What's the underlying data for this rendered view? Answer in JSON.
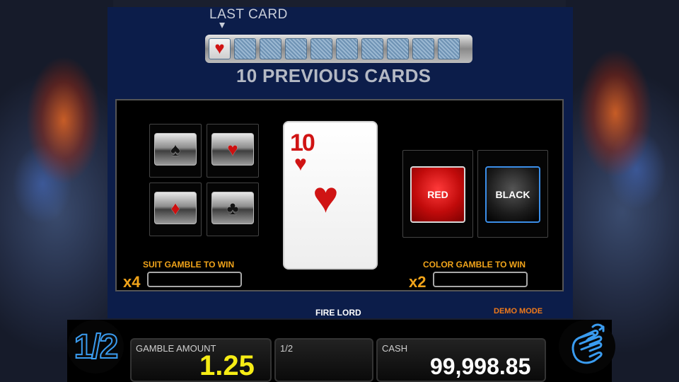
{
  "header": {
    "last_card_label": "LAST CARD",
    "previous_cards_label": "10 PREVIOUS CARDS",
    "history": [
      "♥",
      "",
      "",
      "",
      "",
      "",
      "",
      "",
      "",
      ""
    ]
  },
  "suits": {
    "spade": "♠",
    "heart": "♥",
    "diamond": "♦",
    "club": "♣"
  },
  "current_card": {
    "rank": "10",
    "suit": "♥"
  },
  "color_buttons": {
    "red_label": "RED",
    "black_label": "BLACK"
  },
  "suit_gamble": {
    "label": "SUIT GAMBLE TO WIN",
    "multiplier": "x4",
    "win_value": ""
  },
  "color_gamble": {
    "label": "COLOR GAMBLE TO WIN",
    "multiplier": "x2",
    "win_value": ""
  },
  "footer": {
    "game_name": "FIRE LORD",
    "mode": "DEMO MODE",
    "half_button": "1/2",
    "gamble_amount_label": "GAMBLE AMOUNT",
    "gamble_amount_value": "1.25",
    "half_label": "1/2",
    "cash_label": "CASH",
    "cash_value": "99,998.85"
  },
  "colors": {
    "accent_orange": "#f1a41a",
    "value_yellow": "#f6ec15",
    "panel_blue": "#0c1d4a",
    "card_red": "#d01414",
    "frame_blue": "#3a9cf0"
  }
}
